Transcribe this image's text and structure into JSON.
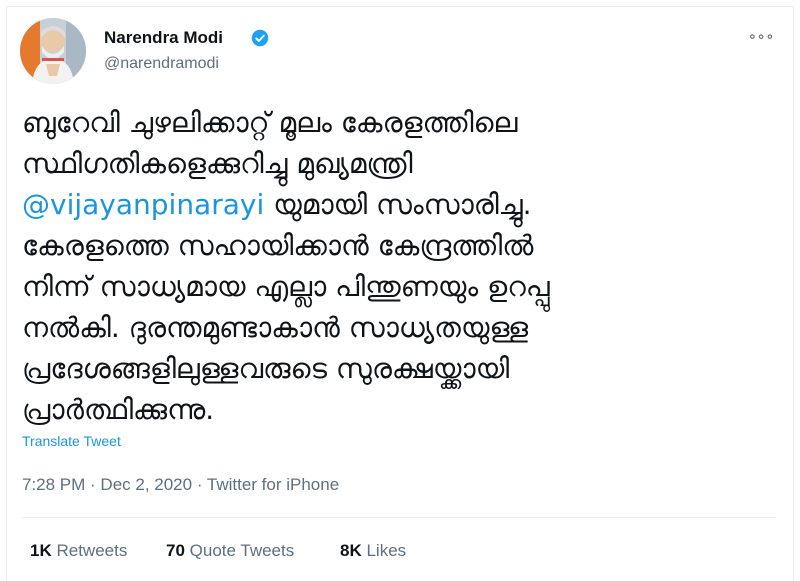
{
  "author": {
    "name": "Narendra Modi",
    "handle": "@narendramodi",
    "verified": true
  },
  "more_icon": "more-icon",
  "tweet": {
    "lines": [
      [
        "ബുറേവി ചുഴലിക്കാറ്റ് മൂലം   കേരളത്തിലെ"
      ],
      [
        "സ്ഥിഗതികളെക്കുറിച്ചു    മുഖ്യമന്ത്രി"
      ],
      [
        "@vijayanpinarayi",
        " യുമായി  സംസാരിച്ചു."
      ],
      [
        "കേരളത്തെ സഹായിക്കാൻ  കേന്ദ്രത്തിൽ"
      ],
      [
        "നിന്ന് സാധ്യമായ എല്ലാ പിന്തുണയും ഉറപ്പു"
      ],
      [
        "നൽകി. ദുരന്തമുണ്ടാകാൻ സാധ്യതയുള്ള"
      ],
      [
        "പ്രദേശങ്ങളിലുള്ളവരുടെ   സുരക്ഷയ്ക്കായി"
      ],
      [
        "പ്രാർത്ഥിക്കുന്നു."
      ]
    ],
    "mention": "@vijayanpinarayi",
    "line3_rest": " യുമായി  സംസാരിച്ചു."
  },
  "translate_label": "Translate Tweet",
  "meta": "7:28 PM · Dec 2, 2020 · Twitter for iPhone",
  "stats": {
    "retweets_count": "1K",
    "retweets_label": "Retweets",
    "quotes_count": "70",
    "quotes_label": "Quote Tweets",
    "likes_count": "8K",
    "likes_label": "Likes"
  },
  "colors": {
    "link": "#1b95e0",
    "verified": "#1da1f2",
    "muted": "#5b7083"
  }
}
